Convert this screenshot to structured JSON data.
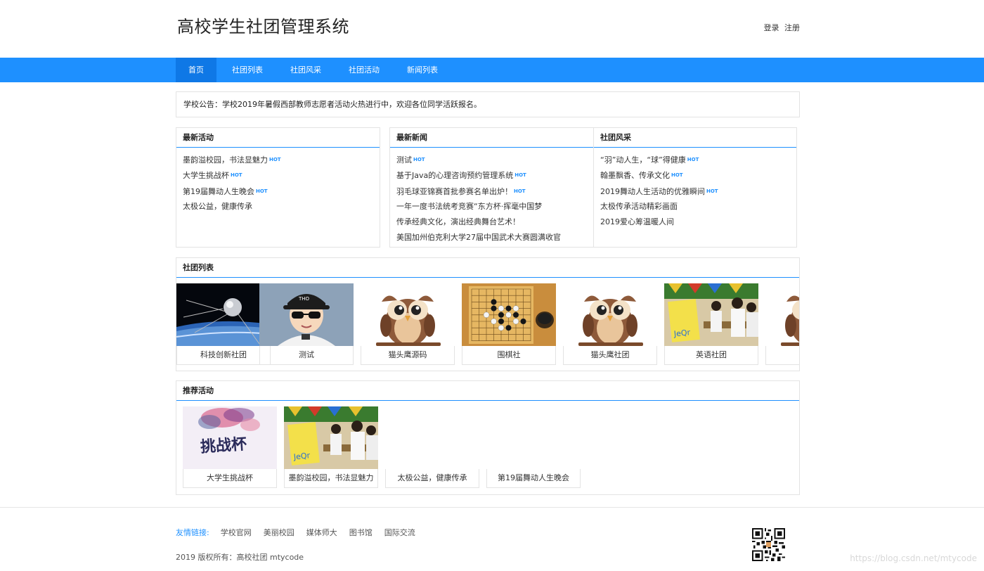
{
  "header": {
    "title": "高校学生社团管理系统",
    "login": "登录",
    "register": "注册"
  },
  "nav": [
    "首页",
    "社团列表",
    "社团风采",
    "社团活动",
    "新闻列表"
  ],
  "notice": "学校公告：学校2019年暑假西部教师志愿者活动火热进行中，欢迎各位同学活跃报名。",
  "hot_label": "HOT",
  "latest_activities": {
    "title": "最新活动",
    "items": [
      {
        "text": "墨韵溢校园，书法显魅力",
        "hot": true
      },
      {
        "text": "大学生挑战杯",
        "hot": true
      },
      {
        "text": "第19届舞动人生晚会",
        "hot": true
      },
      {
        "text": "太极公益，健康传承",
        "hot": false
      }
    ]
  },
  "latest_news": {
    "title": "最新新闻",
    "items": [
      {
        "text": "测试",
        "hot": true
      },
      {
        "text": "基于Java的心理咨询预约管理系统",
        "hot": true
      },
      {
        "text": "羽毛球亚锦赛首批参赛名单出炉！",
        "hot": true
      },
      {
        "text": "一年一度书法统考竞赛“东方杯·挥毫中国梦",
        "hot": false
      },
      {
        "text": "传承经典文化，演出经典舞台艺术！",
        "hot": false
      },
      {
        "text": "美国加州伯克利大学27届中国武术大赛圆满收官",
        "hot": false
      }
    ]
  },
  "club_style": {
    "title": "社团风采",
    "items": [
      {
        "text": "“羽”动人生，“球”得健康",
        "hot": true
      },
      {
        "text": "翰墨飘香、传承文化",
        "hot": true
      },
      {
        "text": "2019舞动人生活动的优雅瞬间",
        "hot": true
      },
      {
        "text": "太极传承活动精彩画面",
        "hot": false
      },
      {
        "text": "2019爱心筹温暖人间",
        "hot": false
      }
    ]
  },
  "club_list": {
    "title": "社团列表",
    "items": [
      {
        "name": "科技创新社团",
        "image": "satellite"
      },
      {
        "name": "测试",
        "image": "avatar"
      },
      {
        "name": "猫头鹰源码",
        "image": "owl"
      },
      {
        "name": "围棋社",
        "image": "go-board"
      },
      {
        "name": "猫头鹰社团",
        "image": "owl"
      },
      {
        "name": "英语社团",
        "image": "classroom"
      },
      {
        "name": "",
        "image": "owl"
      }
    ]
  },
  "recommended": {
    "title": "推荐活动",
    "items": [
      {
        "name": "大学生挑战杯",
        "image": "ink-poster",
        "image_text": "挑战杯"
      },
      {
        "name": "墨韵溢校园，书法显魅力",
        "image": "classroom"
      },
      {
        "name": "太极公益，健康传承",
        "image": ""
      },
      {
        "name": "第19届舞动人生晚会",
        "image": ""
      }
    ]
  },
  "footer": {
    "links_label": "友情链接:",
    "links": [
      "学校官网",
      "美丽校园",
      "媒体师大",
      "图书馆",
      "国际交流"
    ],
    "copyright": "2019 版权所有：高校社团 mtycode",
    "watermark": "https://blog.csdn.net/mtycode"
  },
  "colors": {
    "primary": "#1e90ff",
    "nav_active": "#0f78e6"
  }
}
